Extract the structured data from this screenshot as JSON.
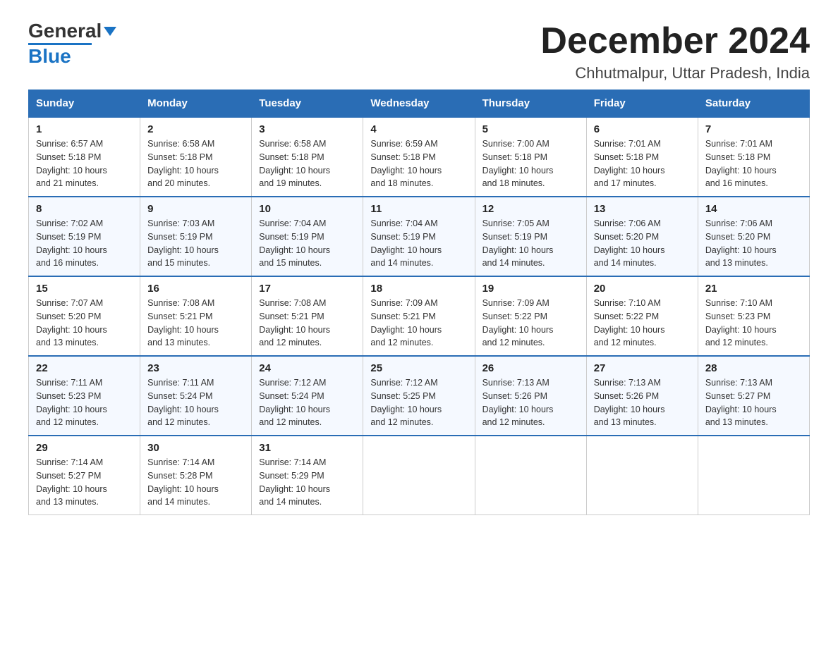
{
  "header": {
    "logo_general": "General",
    "logo_blue": "Blue",
    "month_title": "December 2024",
    "location": "Chhutmalpur, Uttar Pradesh, India"
  },
  "days_of_week": [
    "Sunday",
    "Monday",
    "Tuesday",
    "Wednesday",
    "Thursday",
    "Friday",
    "Saturday"
  ],
  "weeks": [
    [
      {
        "day": "1",
        "sunrise": "6:57 AM",
        "sunset": "5:18 PM",
        "daylight": "10 hours and 21 minutes."
      },
      {
        "day": "2",
        "sunrise": "6:58 AM",
        "sunset": "5:18 PM",
        "daylight": "10 hours and 20 minutes."
      },
      {
        "day": "3",
        "sunrise": "6:58 AM",
        "sunset": "5:18 PM",
        "daylight": "10 hours and 19 minutes."
      },
      {
        "day": "4",
        "sunrise": "6:59 AM",
        "sunset": "5:18 PM",
        "daylight": "10 hours and 18 minutes."
      },
      {
        "day": "5",
        "sunrise": "7:00 AM",
        "sunset": "5:18 PM",
        "daylight": "10 hours and 18 minutes."
      },
      {
        "day": "6",
        "sunrise": "7:01 AM",
        "sunset": "5:18 PM",
        "daylight": "10 hours and 17 minutes."
      },
      {
        "day": "7",
        "sunrise": "7:01 AM",
        "sunset": "5:18 PM",
        "daylight": "10 hours and 16 minutes."
      }
    ],
    [
      {
        "day": "8",
        "sunrise": "7:02 AM",
        "sunset": "5:19 PM",
        "daylight": "10 hours and 16 minutes."
      },
      {
        "day": "9",
        "sunrise": "7:03 AM",
        "sunset": "5:19 PM",
        "daylight": "10 hours and 15 minutes."
      },
      {
        "day": "10",
        "sunrise": "7:04 AM",
        "sunset": "5:19 PM",
        "daylight": "10 hours and 15 minutes."
      },
      {
        "day": "11",
        "sunrise": "7:04 AM",
        "sunset": "5:19 PM",
        "daylight": "10 hours and 14 minutes."
      },
      {
        "day": "12",
        "sunrise": "7:05 AM",
        "sunset": "5:19 PM",
        "daylight": "10 hours and 14 minutes."
      },
      {
        "day": "13",
        "sunrise": "7:06 AM",
        "sunset": "5:20 PM",
        "daylight": "10 hours and 14 minutes."
      },
      {
        "day": "14",
        "sunrise": "7:06 AM",
        "sunset": "5:20 PM",
        "daylight": "10 hours and 13 minutes."
      }
    ],
    [
      {
        "day": "15",
        "sunrise": "7:07 AM",
        "sunset": "5:20 PM",
        "daylight": "10 hours and 13 minutes."
      },
      {
        "day": "16",
        "sunrise": "7:08 AM",
        "sunset": "5:21 PM",
        "daylight": "10 hours and 13 minutes."
      },
      {
        "day": "17",
        "sunrise": "7:08 AM",
        "sunset": "5:21 PM",
        "daylight": "10 hours and 12 minutes."
      },
      {
        "day": "18",
        "sunrise": "7:09 AM",
        "sunset": "5:21 PM",
        "daylight": "10 hours and 12 minutes."
      },
      {
        "day": "19",
        "sunrise": "7:09 AM",
        "sunset": "5:22 PM",
        "daylight": "10 hours and 12 minutes."
      },
      {
        "day": "20",
        "sunrise": "7:10 AM",
        "sunset": "5:22 PM",
        "daylight": "10 hours and 12 minutes."
      },
      {
        "day": "21",
        "sunrise": "7:10 AM",
        "sunset": "5:23 PM",
        "daylight": "10 hours and 12 minutes."
      }
    ],
    [
      {
        "day": "22",
        "sunrise": "7:11 AM",
        "sunset": "5:23 PM",
        "daylight": "10 hours and 12 minutes."
      },
      {
        "day": "23",
        "sunrise": "7:11 AM",
        "sunset": "5:24 PM",
        "daylight": "10 hours and 12 minutes."
      },
      {
        "day": "24",
        "sunrise": "7:12 AM",
        "sunset": "5:24 PM",
        "daylight": "10 hours and 12 minutes."
      },
      {
        "day": "25",
        "sunrise": "7:12 AM",
        "sunset": "5:25 PM",
        "daylight": "10 hours and 12 minutes."
      },
      {
        "day": "26",
        "sunrise": "7:13 AM",
        "sunset": "5:26 PM",
        "daylight": "10 hours and 12 minutes."
      },
      {
        "day": "27",
        "sunrise": "7:13 AM",
        "sunset": "5:26 PM",
        "daylight": "10 hours and 13 minutes."
      },
      {
        "day": "28",
        "sunrise": "7:13 AM",
        "sunset": "5:27 PM",
        "daylight": "10 hours and 13 minutes."
      }
    ],
    [
      {
        "day": "29",
        "sunrise": "7:14 AM",
        "sunset": "5:27 PM",
        "daylight": "10 hours and 13 minutes."
      },
      {
        "day": "30",
        "sunrise": "7:14 AM",
        "sunset": "5:28 PM",
        "daylight": "10 hours and 14 minutes."
      },
      {
        "day": "31",
        "sunrise": "7:14 AM",
        "sunset": "5:29 PM",
        "daylight": "10 hours and 14 minutes."
      },
      null,
      null,
      null,
      null
    ]
  ],
  "labels": {
    "sunrise": "Sunrise:",
    "sunset": "Sunset:",
    "daylight": "Daylight:"
  }
}
